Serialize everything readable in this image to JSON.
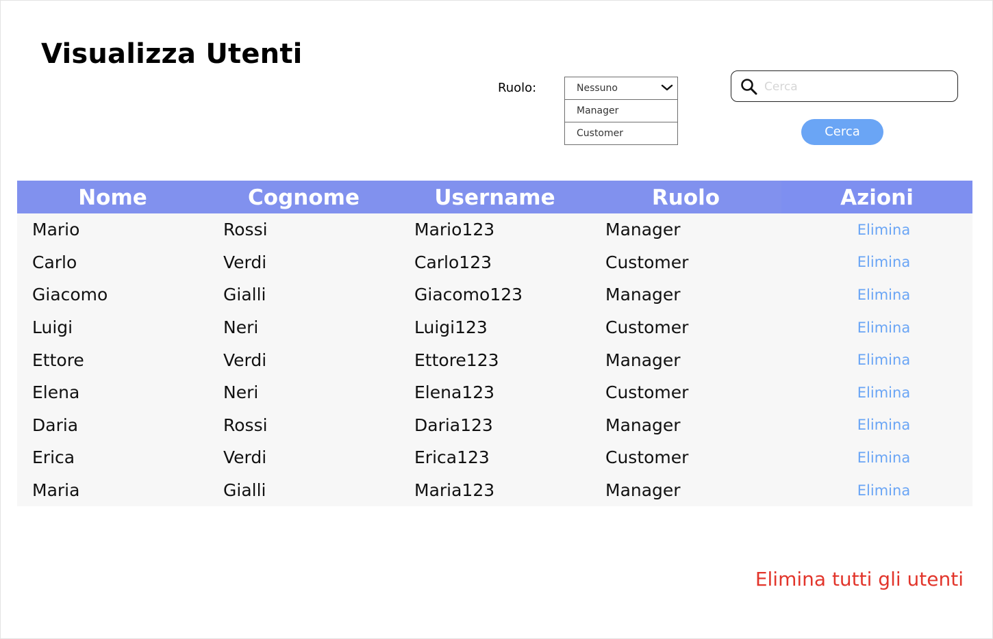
{
  "page": {
    "title": "Visualizza Utenti"
  },
  "filter": {
    "role_label": "Ruolo:",
    "role_options": [
      "Nessuno",
      "Manager",
      "Customer"
    ]
  },
  "search": {
    "placeholder": "Cerca",
    "value": "",
    "button_label": "Cerca"
  },
  "table": {
    "columns": [
      "Nome",
      "Cognome",
      "Username",
      "Ruolo",
      "Azioni"
    ],
    "rows": [
      {
        "nome": "Mario",
        "cognome": "Rossi",
        "username": "Mario123",
        "ruolo": "Manager",
        "azione": "Elimina"
      },
      {
        "nome": "Carlo",
        "cognome": "Verdi",
        "username": "Carlo123",
        "ruolo": "Customer",
        "azione": "Elimina"
      },
      {
        "nome": "Giacomo",
        "cognome": "Gialli",
        "username": "Giacomo123",
        "ruolo": "Manager",
        "azione": "Elimina"
      },
      {
        "nome": "Luigi",
        "cognome": "Neri",
        "username": "Luigi123",
        "ruolo": "Customer",
        "azione": "Elimina"
      },
      {
        "nome": "Ettore",
        "cognome": "Verdi",
        "username": "Ettore123",
        "ruolo": "Manager",
        "azione": "Elimina"
      },
      {
        "nome": "Elena",
        "cognome": "Neri",
        "username": "Elena123",
        "ruolo": "Customer",
        "azione": "Elimina"
      },
      {
        "nome": "Daria",
        "cognome": "Rossi",
        "username": "Daria123",
        "ruolo": "Manager",
        "azione": "Elimina"
      },
      {
        "nome": "Erica",
        "cognome": "Verdi",
        "username": "Erica123",
        "ruolo": "Customer",
        "azione": "Elimina"
      },
      {
        "nome": "Maria",
        "cognome": "Gialli",
        "username": "Maria123",
        "ruolo": "Manager",
        "azione": "Elimina"
      }
    ]
  },
  "footer": {
    "delete_all_label": "Elimina tutti gli utenti"
  },
  "colors": {
    "header_bg": "#8191ee",
    "accent_blue": "#6aa5f5",
    "danger_red": "#e2352b"
  },
  "icons": {
    "search": "search-icon",
    "dropdown": "chevron-down-icon"
  }
}
